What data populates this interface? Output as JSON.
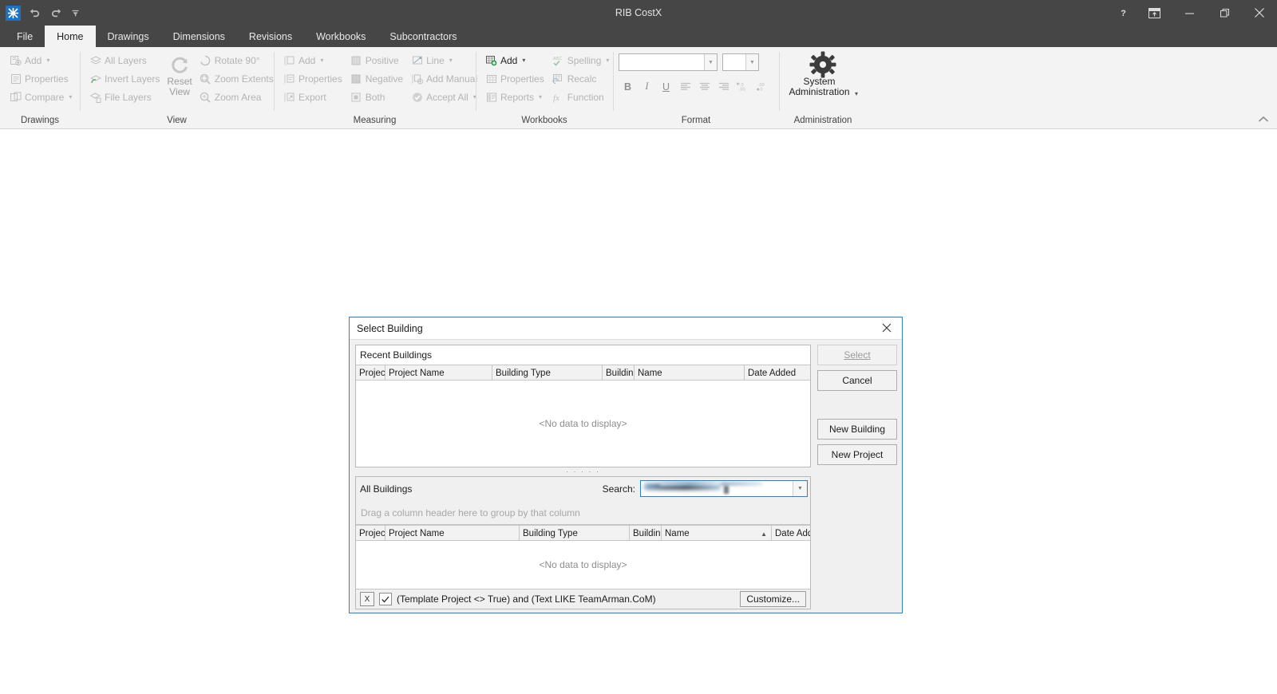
{
  "window": {
    "title": "RIB CostX",
    "quick_access": [
      {
        "name": "app-logo",
        "label": "RIB"
      },
      {
        "name": "undo-icon",
        "label": "Undo"
      },
      {
        "name": "redo-icon",
        "label": "Redo"
      },
      {
        "name": "customize-quick-access-icon",
        "label": "Customize Quick Access Toolbar"
      }
    ],
    "controls": [
      {
        "name": "help-button",
        "label": "?"
      },
      {
        "name": "ribbon-display-options-button",
        "label": "Ribbon Display Options"
      },
      {
        "name": "minimize-button",
        "label": "Minimize"
      },
      {
        "name": "restore-button",
        "label": "Restore"
      },
      {
        "name": "close-button",
        "label": "Close"
      }
    ]
  },
  "tabs": [
    {
      "label": "File",
      "active": false
    },
    {
      "label": "Home",
      "active": true
    },
    {
      "label": "Drawings",
      "active": false
    },
    {
      "label": "Dimensions",
      "active": false
    },
    {
      "label": "Revisions",
      "active": false
    },
    {
      "label": "Workbooks",
      "active": false
    },
    {
      "label": "Subcontractors",
      "active": false
    }
  ],
  "ribbon": {
    "collapse_label": "Collapse the Ribbon",
    "groups": {
      "drawings": {
        "title": "Drawings",
        "items": [
          {
            "label": "Add",
            "icon": "add-drawing-icon",
            "caret": true,
            "enabled": false
          },
          {
            "label": "Properties",
            "icon": "drawing-properties-icon",
            "caret": false,
            "enabled": false
          },
          {
            "label": "Compare",
            "icon": "compare-drawings-icon",
            "caret": true,
            "enabled": false
          }
        ]
      },
      "view": {
        "title": "View",
        "layers": [
          {
            "label": "All Layers",
            "icon": "all-layers-icon",
            "enabled": false
          },
          {
            "label": "Invert Layers",
            "icon": "invert-layers-icon",
            "enabled": false
          },
          {
            "label": "File Layers",
            "icon": "file-layers-icon",
            "enabled": false
          }
        ],
        "reset_view": {
          "label": "Reset View",
          "icon": "reset-view-icon",
          "enabled": false
        },
        "zoom": [
          {
            "label": "Rotate 90°",
            "icon": "rotate-90-icon",
            "enabled": false
          },
          {
            "label": "Zoom Extents",
            "icon": "zoom-extents-icon",
            "enabled": false
          },
          {
            "label": "Zoom Area",
            "icon": "zoom-area-icon",
            "enabled": false
          }
        ]
      },
      "measuring": {
        "title": "Measuring",
        "col1": [
          {
            "label": "Add",
            "icon": "add-dimension-icon",
            "caret": true,
            "enabled": false
          },
          {
            "label": "Properties",
            "icon": "dimension-properties-icon",
            "caret": false,
            "enabled": false
          },
          {
            "label": "Export",
            "icon": "export-dimension-icon",
            "caret": false,
            "enabled": false
          }
        ],
        "col2": [
          {
            "label": "Positive",
            "icon": "positive-icon",
            "caret": false,
            "enabled": false
          },
          {
            "label": "Negative",
            "icon": "negative-icon",
            "caret": false,
            "enabled": false
          },
          {
            "label": "Both",
            "icon": "both-icon",
            "caret": false,
            "enabled": false
          }
        ],
        "col3": [
          {
            "label": "Line",
            "icon": "line-icon",
            "caret": true,
            "enabled": false
          },
          {
            "label": "Add Manual",
            "icon": "add-manual-icon",
            "caret": false,
            "enabled": false
          },
          {
            "label": "Accept All",
            "icon": "accept-all-icon",
            "caret": true,
            "enabled": false
          }
        ]
      },
      "workbooks": {
        "title": "Workbooks",
        "col1": [
          {
            "label": "Add",
            "icon": "add-workbook-icon",
            "caret": true,
            "enabled": true
          },
          {
            "label": "Properties",
            "icon": "workbook-properties-icon",
            "caret": false,
            "enabled": false
          },
          {
            "label": "Reports",
            "icon": "reports-icon",
            "caret": true,
            "enabled": false
          }
        ],
        "col2": [
          {
            "label": "Spelling",
            "icon": "spelling-icon",
            "caret": true,
            "enabled": false
          },
          {
            "label": "Recalc",
            "icon": "recalc-icon",
            "caret": false,
            "enabled": false
          },
          {
            "label": "Function",
            "icon": "function-icon",
            "caret": false,
            "enabled": false
          }
        ]
      },
      "format": {
        "title": "Format",
        "font_name": "",
        "font_size": "",
        "buttons": [
          {
            "label": "B",
            "name": "bold-button"
          },
          {
            "label": "I",
            "name": "italic-button"
          },
          {
            "label": "U",
            "name": "underline-button"
          },
          {
            "label": "align-left",
            "name": "align-left-button"
          },
          {
            "label": "align-center",
            "name": "align-center-button"
          },
          {
            "label": "align-right",
            "name": "align-right-button"
          },
          {
            "label": "decrease-decimal",
            "name": "decrease-decimal-button"
          },
          {
            "label": "increase-decimal",
            "name": "increase-decimal-button"
          }
        ]
      },
      "administration": {
        "title": "Administration",
        "button": {
          "label": "System Administration",
          "icon": "gear-icon",
          "caret": true,
          "enabled": true
        }
      }
    }
  },
  "dialog": {
    "title": "Select Building",
    "close_label": "Close",
    "recent": {
      "header": "Recent Buildings",
      "columns": [
        "Projec",
        "Project Name",
        "Building Type",
        "Buildin",
        "Name",
        "Date Added"
      ],
      "empty_text": "<No data to display>"
    },
    "all": {
      "header": "All Buildings",
      "search_label": "Search:",
      "search_value": "",
      "group_hint": "Drag a column header here to group by that column",
      "columns": [
        "Projec",
        "Project Name",
        "Building Type",
        "Buildin",
        "Name",
        "Date Added"
      ],
      "sorted_column": "Name",
      "empty_text": "<No data to display>"
    },
    "filter": {
      "enabled": true,
      "expression": "(Template Project <> True) and (Text LIKE TeamArman.CoM)",
      "clear_label": "X",
      "customize_label": "Customize..."
    },
    "buttons": [
      {
        "name": "select-button",
        "label": "Select",
        "accel": "S",
        "enabled": false
      },
      {
        "name": "cancel-button",
        "label": "Cancel",
        "accel": "C",
        "enabled": true
      },
      {
        "name": "new-building-button",
        "label": "New Building",
        "accel": "N",
        "enabled": true
      },
      {
        "name": "new-project-button",
        "label": "New Project",
        "accel": "P",
        "enabled": true
      }
    ]
  },
  "colors": {
    "titlebar": "#464646",
    "ribbon": "#f3f3f3",
    "accent": "#1c72c4",
    "dialog_border": "#2a7fc9"
  }
}
